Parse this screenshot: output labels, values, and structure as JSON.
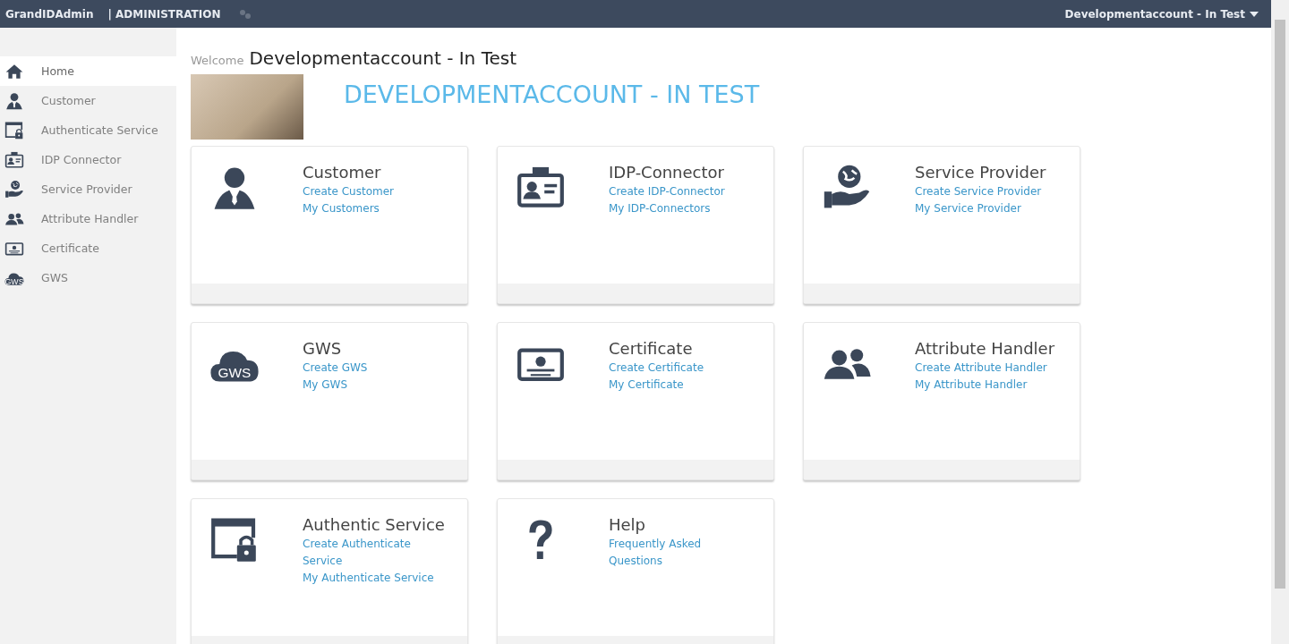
{
  "topbar": {
    "brand": "GrandIDAdmin",
    "section": "| ADMINISTRATION",
    "account": "Developmentaccount - In Test"
  },
  "sidebar": {
    "items": [
      {
        "kind": "home",
        "label": "Home",
        "selected": true
      },
      {
        "kind": "customer",
        "label": "Customer",
        "selected": false
      },
      {
        "kind": "auth",
        "label": "Authenticate Service",
        "selected": false
      },
      {
        "kind": "idp",
        "label": "IDP Connector",
        "selected": false
      },
      {
        "kind": "provider",
        "label": "Service Provider",
        "selected": false
      },
      {
        "kind": "attribute",
        "label": "Attribute Handler",
        "selected": false
      },
      {
        "kind": "certificate",
        "label": "Certificate",
        "selected": false
      },
      {
        "kind": "gws",
        "label": "GWS",
        "selected": false,
        "icon_label": "GWS"
      }
    ]
  },
  "welcome": {
    "prefix": "Welcome",
    "name": "Developmentaccount - In Test",
    "heading": "DEVELOPMENTACCOUNT - IN TEST"
  },
  "cards": [
    {
      "kind": "customer",
      "title": "Customer",
      "links": [
        "Create Customer",
        "My Customers"
      ]
    },
    {
      "kind": "idp",
      "title": "IDP-Connector",
      "links": [
        "Create IDP-Connector",
        "My IDP-Connectors"
      ]
    },
    {
      "kind": "provider",
      "title": "Service Provider",
      "links": [
        "Create Service Provider",
        "My Service Provider"
      ]
    },
    {
      "kind": "gws",
      "title": "GWS",
      "links": [
        "Create GWS",
        "My GWS"
      ],
      "icon_label": "GWS"
    },
    {
      "kind": "certificate",
      "title": "Certificate",
      "links": [
        "Create Certificate",
        "My Certificate"
      ]
    },
    {
      "kind": "attribute",
      "title": "Attribute Handler",
      "links": [
        "Create Attribute Handler",
        "My Attribute Handler"
      ]
    },
    {
      "kind": "auth",
      "title": "Authentic Service",
      "links": [
        "Create Authenticate Service",
        "My Authenticate Service"
      ]
    },
    {
      "kind": "help",
      "title": "Help",
      "links": [
        "Frequently Asked Questions"
      ]
    }
  ]
}
